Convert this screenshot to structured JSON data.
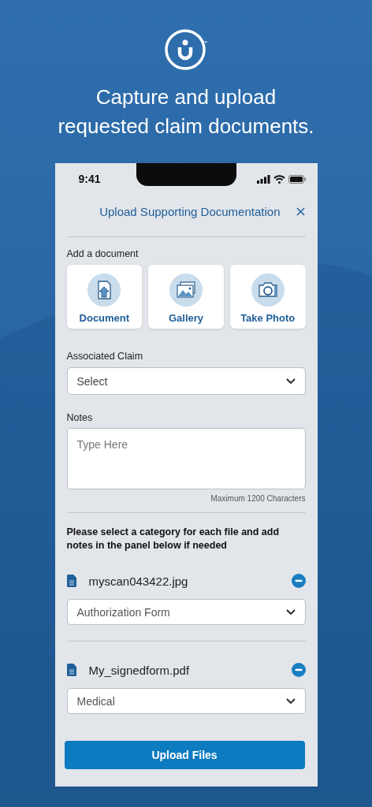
{
  "logo": {
    "mark": "™"
  },
  "headline": [
    "Capture and upload",
    "requested claim documents."
  ],
  "status_bar": {
    "time": "9:41"
  },
  "header": {
    "title": "Upload Supporting Documentation"
  },
  "add_document": {
    "label": "Add a document",
    "options": [
      {
        "label": "Document",
        "kind": "document"
      },
      {
        "label": "Gallery",
        "kind": "gallery"
      },
      {
        "label": "Take Photo",
        "kind": "camera"
      }
    ]
  },
  "associated_claim": {
    "label": "Associated Claim",
    "placeholder": "Select"
  },
  "notes": {
    "label": "Notes",
    "placeholder": "Type Here",
    "hint": "Maximum 1200 Characters"
  },
  "instruction": "Please select a category for each file and add notes in the panel below if needed",
  "files": [
    {
      "name": "myscan043422.jpg",
      "category": "Authorization Form"
    },
    {
      "name": "My_signedform.pdf",
      "category": "Medical"
    }
  ],
  "submit": "Upload Files"
}
